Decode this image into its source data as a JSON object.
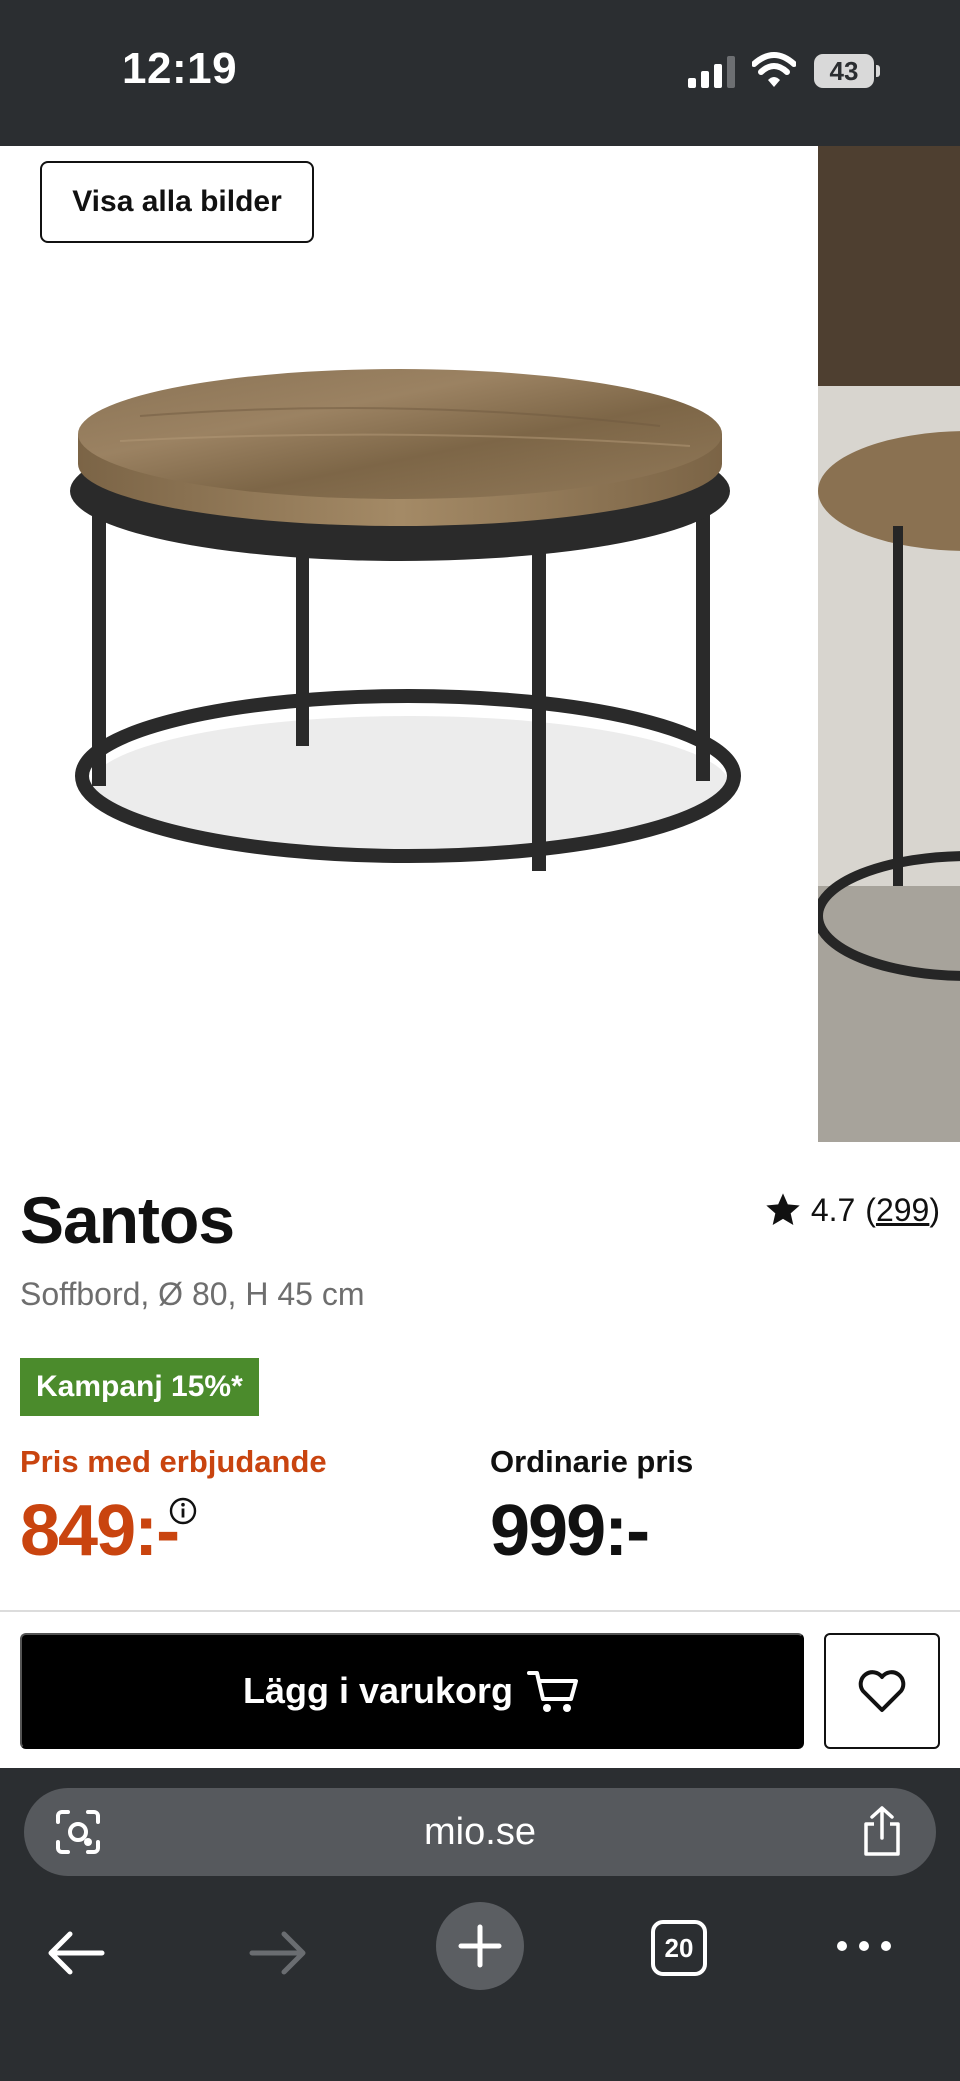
{
  "status_bar": {
    "time": "12:19",
    "battery": "43"
  },
  "gallery": {
    "view_all_label": "Visa alla bilder"
  },
  "product": {
    "title": "Santos",
    "subtitle": "Soffbord, Ø 80, H 45 cm",
    "rating": "4.7",
    "rating_open": "(",
    "rating_count": "299",
    "rating_close": ")",
    "campaign_badge": "Kampanj 15%*",
    "offer_label": "Pris med erbjudande",
    "offer_price": "849:-",
    "regular_label": "Ordinarie pris",
    "regular_price": "999:-"
  },
  "actions": {
    "add_to_cart_label": "Lägg i varukorg",
    "cart_icon": "cart-icon",
    "wishlist_icon": "heart-icon"
  },
  "browser": {
    "url": "mio.se",
    "tab_count": "20"
  },
  "colors": {
    "campaign_green": "#4b8b2c",
    "offer_orange": "#c9440f",
    "chrome_dark": "#2b2e31"
  }
}
